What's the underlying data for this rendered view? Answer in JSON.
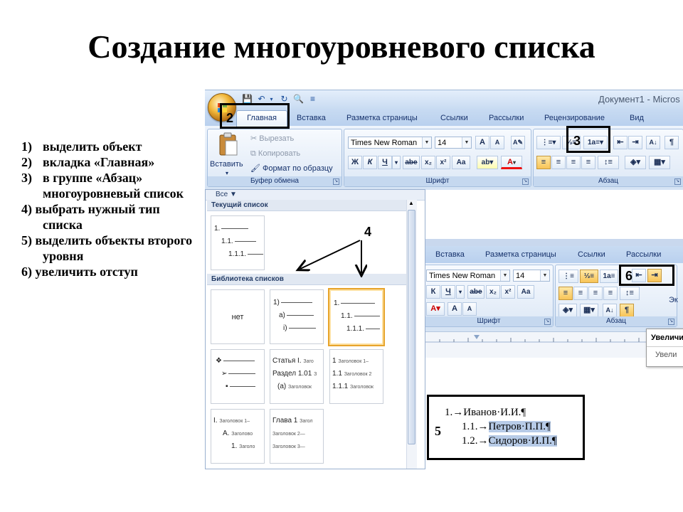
{
  "slide": {
    "title": "Создание многоуровневого списка",
    "steps": [
      {
        "num": "1)",
        "text": "выделить объект"
      },
      {
        "num": "2)",
        "text": "вкладка «Главная»"
      },
      {
        "num": "3)",
        "text": "в группе «Абзац» многоуровневый список"
      },
      {
        "num": "4)",
        "text": "выбрать нужный тип списка"
      },
      {
        "num": "5)",
        "text": "выделить объекты второго уровня"
      },
      {
        "num": "6)",
        "text": "увеличить отступ"
      }
    ]
  },
  "ribbon": {
    "doc_title": "Документ1 - Micros",
    "tabs": [
      "Главная",
      "Вставка",
      "Разметка страницы",
      "Ссылки",
      "Рассылки",
      "Рецензирование",
      "Вид"
    ],
    "clipboard": {
      "paste": "Вставить",
      "cut": "Вырезать",
      "copy": "Копировать",
      "format_painter": "Формат по образцу",
      "label": "Буфер обмена"
    },
    "font": {
      "name": "Times New Roman",
      "size": "14",
      "label": "Шрифт",
      "bold": "Ж",
      "italic": "К",
      "underline": "Ч",
      "strike": "abe",
      "subscript": "x₂",
      "superscript": "x²",
      "case": "Aa",
      "grow": "A",
      "shrink": "A",
      "font_color": "A"
    },
    "paragraph": {
      "label": "Абзац",
      "pilcrow": "¶"
    }
  },
  "callouts": {
    "c2": "2",
    "c3": "3",
    "c4": "4",
    "c5": "5",
    "c6": "6"
  },
  "gallery": {
    "filter": "Все",
    "current_header": "Текущий список",
    "library_header": "Библиотека списков",
    "current": {
      "l1": "1.",
      "l2": "1.1.",
      "l3": "1.1.1."
    },
    "none_label": "нет",
    "item2": {
      "l1": "1)",
      "l2": "a)",
      "l3": "i)"
    },
    "item3": {
      "l1": "1.",
      "l2": "1.1.",
      "l3": "1.1.1."
    },
    "item5": {
      "l1a": "Статья I.",
      "l1b": "Заго",
      "l2a": "Раздел 1.01",
      "l2b": "З",
      "l3a": "(a)",
      "l3b": "Заголовок"
    },
    "item6": {
      "l1a": "1",
      "l1b": "Заголовок 1–",
      "l2a": "1.1",
      "l2b": "Заголовок 2",
      "l3a": "1.1.1",
      "l3b": "Заголовок"
    },
    "item7": {
      "l1a": "I.",
      "l1b": "Заголовок 1–",
      "l2a": "A.",
      "l2b": "Заголово",
      "l3a": "1.",
      "l3b": "Заголо"
    },
    "item8": {
      "l1a": "Глава 1",
      "l1b": "Загол",
      "l2": "Заголовок 2—",
      "l3": "Заголовок 3—"
    }
  },
  "ribbon2": {
    "tabs": [
      "Вставка",
      "Разметка страницы",
      "Ссылки",
      "Рассылки"
    ],
    "font_name": "Times New Roman",
    "font_size": "14",
    "font_label": "Шрифт",
    "para_label": "Абзац",
    "extra": "Эк",
    "tooltip_title": "Увеличи",
    "tooltip_sub": "Увели"
  },
  "sample": {
    "lines": [
      {
        "num": "1.→",
        "text": "Иванов·И.И.¶"
      },
      {
        "num": "1.1.→",
        "text": "Петров·П.П.¶"
      },
      {
        "num": "1.2.→",
        "text": "Сидоров·И.П.¶"
      }
    ]
  }
}
